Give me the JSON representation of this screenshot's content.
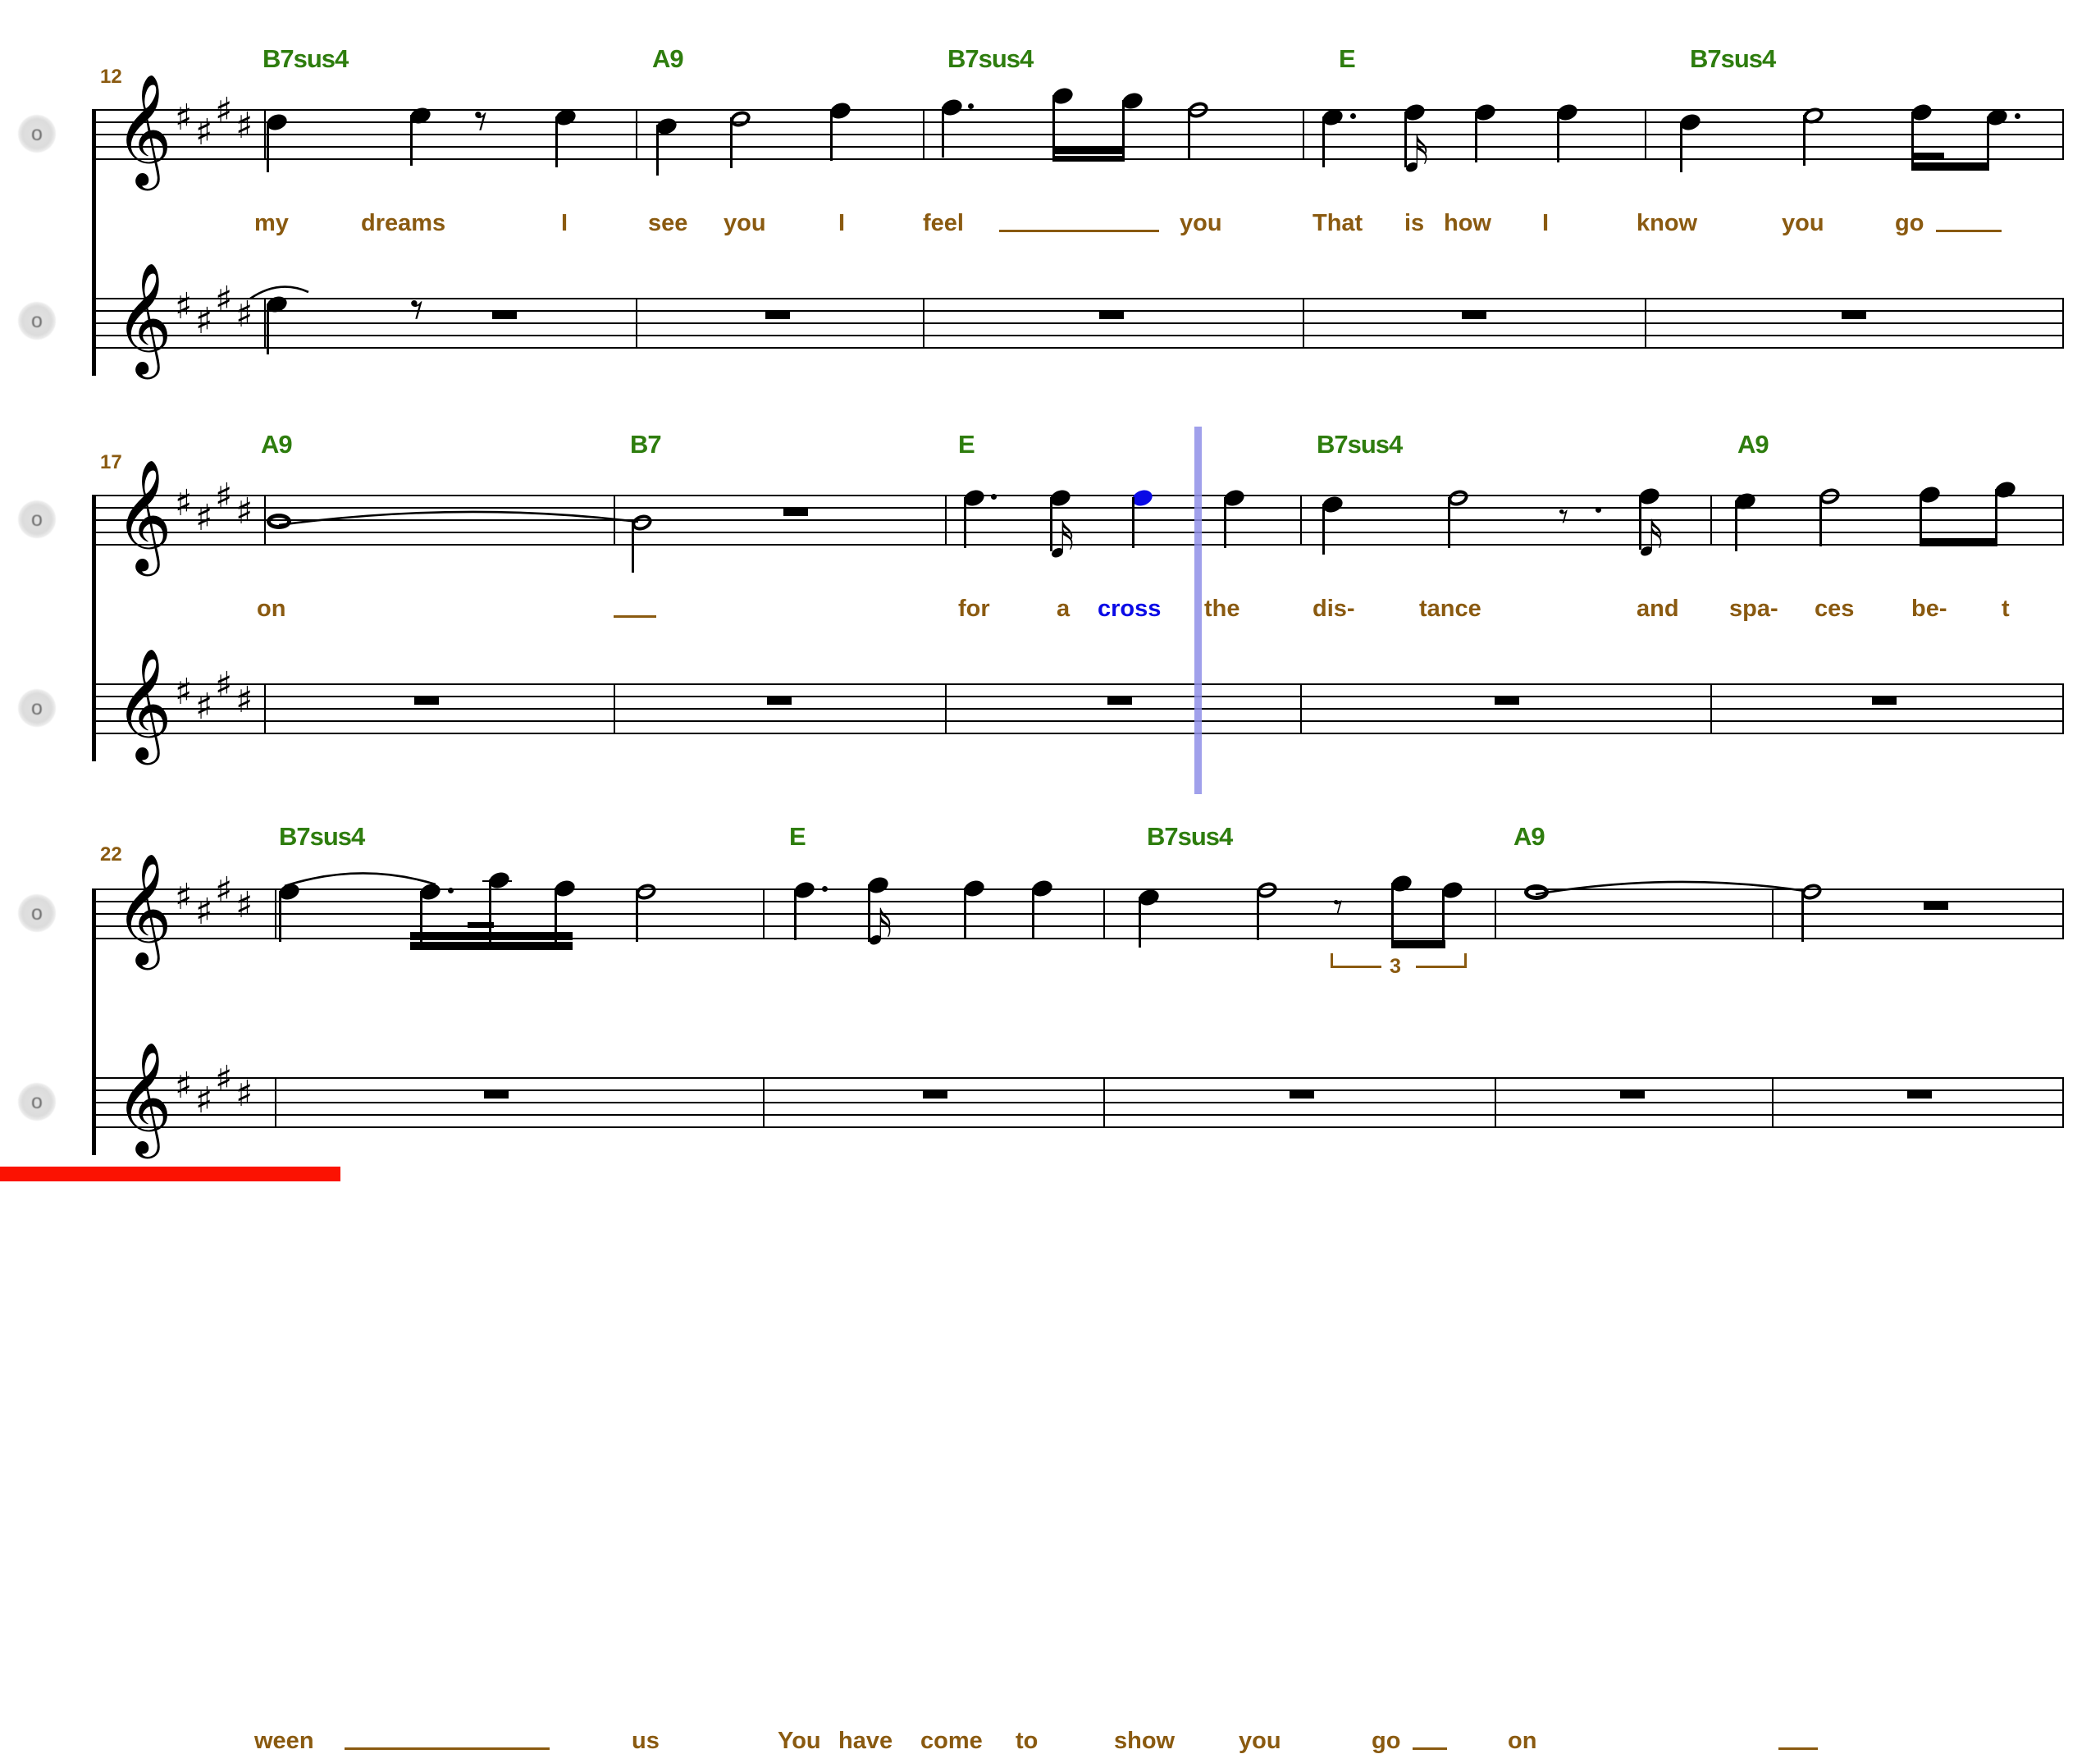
{
  "document": {
    "title": "Score",
    "key_signature": "4 sharps (E major)",
    "clef_glyph": "𝄞",
    "keysig_glyph": "♯"
  },
  "playback": {
    "cursor_label": "playback-cursor",
    "cursor_color": "#8f8fe8",
    "selected_note_color": "#0a0ae6",
    "progress_percent": 16,
    "progress_color": "#fb1202"
  },
  "colors": {
    "chord": "#2e7d0e",
    "lyric": "#8a5a10",
    "measure_number": "#8a5a10",
    "selection": "#0a0ae6"
  },
  "instrument_handles": [
    {
      "label": "o",
      "name": "staff-handle-1"
    },
    {
      "label": "o",
      "name": "staff-handle-2"
    },
    {
      "label": "o",
      "name": "staff-handle-3"
    },
    {
      "label": "o",
      "name": "staff-handle-4"
    },
    {
      "label": "o",
      "name": "staff-handle-5"
    },
    {
      "label": "o",
      "name": "staff-handle-6"
    }
  ],
  "systems": [
    {
      "measure_number": "12",
      "chords": [
        "B7sus4",
        "A9",
        "B7sus4",
        "E",
        "B7sus4"
      ],
      "lyrics": [
        "my",
        "dreams",
        "I",
        "see",
        "you",
        "I",
        "feel",
        "you",
        "That",
        "is",
        "how",
        "I",
        "know",
        "you",
        "go"
      ],
      "lyric_melismas": 2
    },
    {
      "measure_number": "17",
      "chords": [
        "A9",
        "B7",
        "E",
        "B7sus4",
        "A9"
      ],
      "lyrics": [
        "on",
        "for",
        "a",
        "cross",
        "the",
        "dis-",
        "tance",
        "and",
        "spa-",
        "ces",
        "be-",
        "t"
      ],
      "selected_lyric": "cross",
      "lyric_melismas": 1
    },
    {
      "measure_number": "22",
      "chords": [
        "B7sus4",
        "E",
        "B7sus4",
        "A9"
      ],
      "lyrics": [
        "ween",
        "us",
        "You",
        "have",
        "come",
        "to",
        "show",
        "you",
        "go",
        "on"
      ],
      "tuplet": "3",
      "lyric_melismas": 3
    }
  ]
}
